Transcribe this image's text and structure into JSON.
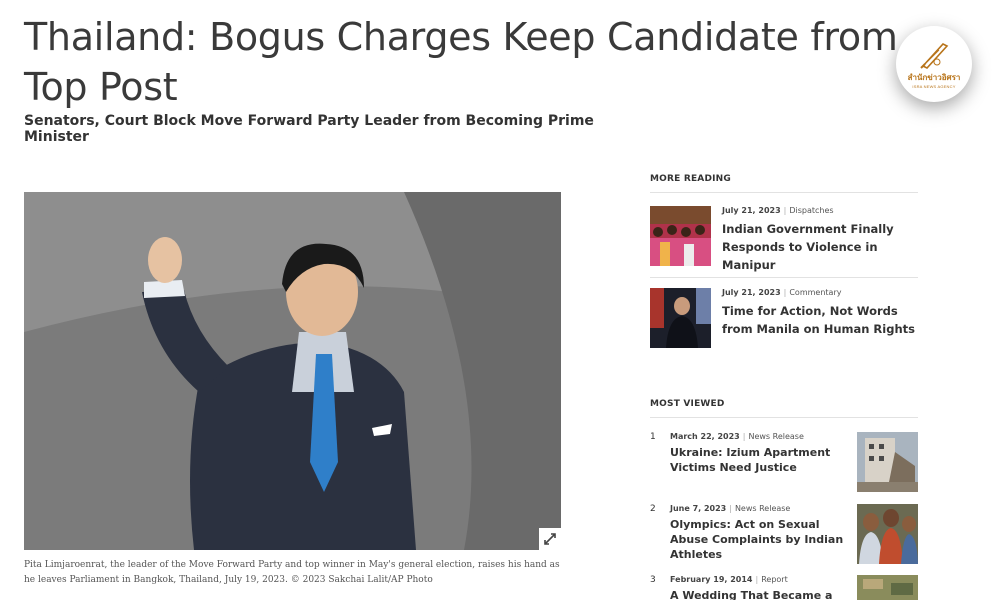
{
  "article": {
    "headline": "Thailand: Bogus Charges Keep Candidate from Top Post",
    "subheadline": "Senators, Court Block Move Forward Party Leader from Becoming Prime Minister",
    "caption": "Pita Limjaroenrat, the leader of the Move Forward Party and top winner in May's general election, raises his hand as he leaves Parliament in Bangkok, Thailand, July 19, 2023. © 2023 Sakchai Lalit/AP Photo"
  },
  "watermark": {
    "name_thai": "สำนักข่าวอิศรา",
    "name_en": "ISRA NEWS AGENCY"
  },
  "sidebar": {
    "more_reading_heading": "MORE READING",
    "more_reading": [
      {
        "date": "July 21, 2023",
        "category": "Dispatches",
        "title": "Indian Government Finally Responds to Violence in Manipur"
      },
      {
        "date": "July 21, 2023",
        "category": "Commentary",
        "title": "Time for Action, Not Words from Manila on Human Rights"
      }
    ],
    "most_viewed_heading": "MOST VIEWED",
    "most_viewed": [
      {
        "rank": "1",
        "date": "March 22, 2023",
        "category": "News Release",
        "title": "Ukraine: Izium Apartment Victims Need Justice"
      },
      {
        "rank": "2",
        "date": "June 7, 2023",
        "category": "News Release",
        "title": "Olympics: Act on Sexual Abuse Complaints by Indian Athletes"
      },
      {
        "rank": "3",
        "date": "February 19, 2014",
        "category": "Report",
        "title": "A Wedding That Became a Funeral"
      }
    ],
    "separator": "|"
  },
  "colors": {
    "seal_gold": "#b8741a",
    "text_dark": "#333333"
  }
}
